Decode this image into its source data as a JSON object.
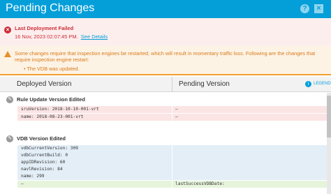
{
  "dialog": {
    "title": "Pending Changes",
    "help_glyph": "?",
    "close_glyph": "×"
  },
  "error": {
    "title": "Last Deployment Failed",
    "time": "16 Nov, 2023 02:07:45 PM.",
    "link": "See Details"
  },
  "warning": {
    "message": "Some changes require that inspection engines be restarted, which will result in momentary traffic loss. Following are the changes that require inspection engine restart:",
    "bullet": "• The VDB was updated."
  },
  "columns": {
    "deployed": "Deployed Version",
    "pending": "Pending Version",
    "legend": "LEGEND"
  },
  "sections": [
    {
      "title": "Rule Update Version Edited",
      "rows": [
        {
          "left": "sruVersion: 2018-10-10-001-vrt",
          "right": "–"
        },
        {
          "left": "name: 2018-08-23-001-vrt",
          "right": "–"
        }
      ]
    },
    {
      "title": "VDB Version Edited",
      "rows": [
        {
          "left": "vdbCurrentVersion: 309",
          "right": ""
        },
        {
          "left": "vdbCurrentBuild: 0",
          "right": ""
        },
        {
          "left": "appIDRevision: 60",
          "right": ""
        },
        {
          "left": "navlRevision: 84",
          "right": ""
        },
        {
          "left": "name: 299",
          "right": ""
        },
        {
          "left": "–",
          "right": "lastSuccessVDBDate:"
        }
      ]
    }
  ],
  "colors": {
    "header": "#049fd9",
    "error": "#cc2d37",
    "warning": "#d97a1a",
    "removed": "#fbe4e4",
    "changed": "#e3eef7",
    "added": "#e6f4dc"
  }
}
